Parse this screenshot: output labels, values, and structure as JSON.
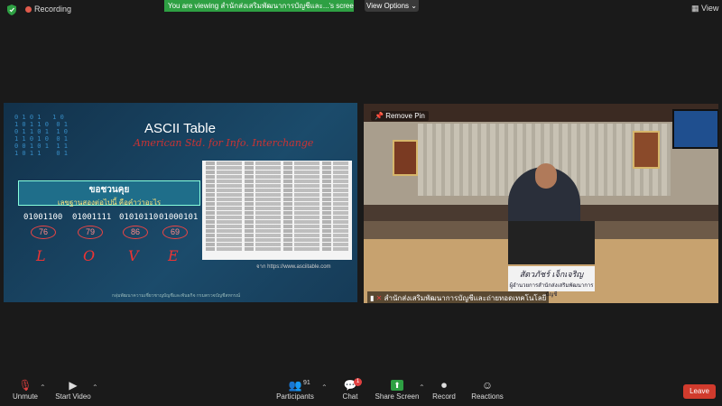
{
  "topbar": {
    "recording_label": "Recording",
    "viewing_banner": "You are viewing สำนักส่งเสริมพัฒนาการบัญชีและ...'s screen",
    "view_options_label": "View Options",
    "view_label": "View"
  },
  "shared_screen": {
    "title": "ASCII Table",
    "subtitle": "American Std. for Info. Interchange",
    "question_line1": "ขอชวนคุย",
    "question_line2": "เลขฐานสองต่อไปนี้ คือคำว่าอะไร",
    "binary": [
      "01001100",
      "01001111",
      "01010110",
      "01000101"
    ],
    "decimal": [
      "76",
      "79",
      "86",
      "69"
    ],
    "letters": [
      "L",
      "O",
      "V",
      "E"
    ],
    "source": "จาก https://www.asciitable.com",
    "footer": "กลุ่มพัฒนาความเชี่ยวชาญบัญชีและพันธกิจ กรมตรวจบัญชีสหกรณ์"
  },
  "webcam": {
    "remove_pin_label": "Remove Pin",
    "nameplate_name": "สัตวภัชร์ เจ็กเจริญ",
    "nameplate_title": "ผู้อำนวยการสำนักส่งเสริมพัฒนาการบัญชี",
    "participant_label": "สำนักส่งเสริมพัฒนาการบัญชีและถ่ายทอดเทคโนโลยี"
  },
  "toolbar": {
    "unmute_label": "Unmute",
    "start_video_label": "Start Video",
    "participants_label": "Participants",
    "participants_count": "91",
    "chat_label": "Chat",
    "chat_badge": "1",
    "share_screen_label": "Share Screen",
    "record_label": "Record",
    "reactions_label": "Reactions",
    "leave_label": "Leave"
  },
  "colors": {
    "share_green": "#2ea043",
    "leave_red": "#d13b2d",
    "background": "#1a1a1a"
  }
}
